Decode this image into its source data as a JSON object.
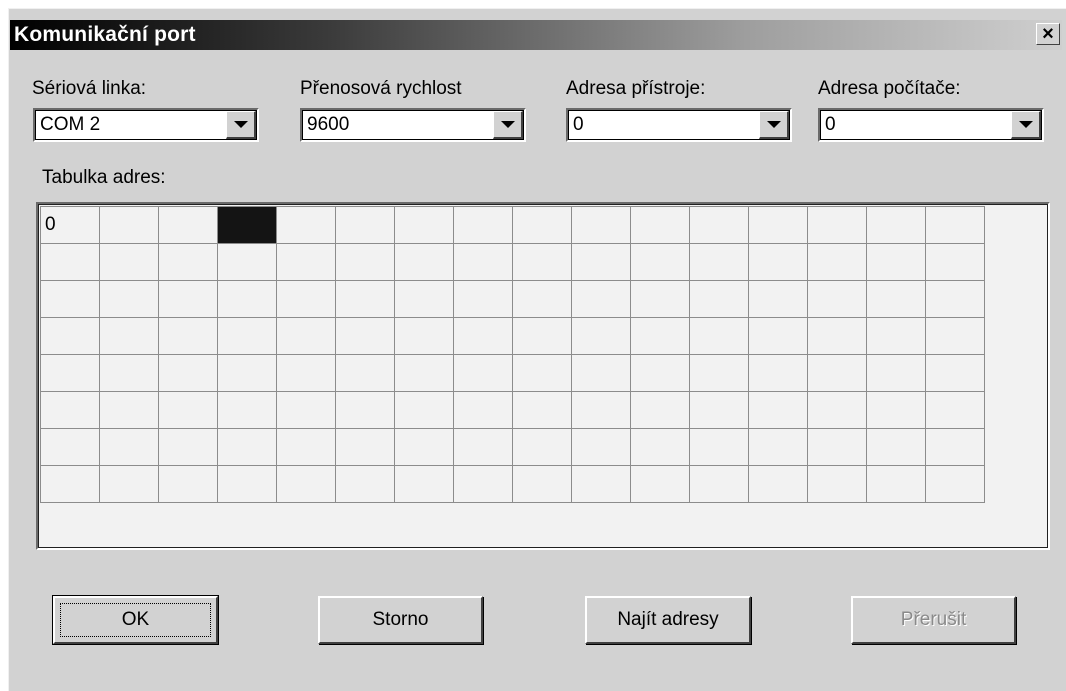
{
  "window": {
    "title": "Komunikační port",
    "close_label": "×"
  },
  "fields": [
    {
      "label": "Sériová linka:",
      "value": "COM 2"
    },
    {
      "label": "Přenosová rychlost",
      "value": "9600"
    },
    {
      "label": "Adresa přístroje:",
      "value": "0"
    },
    {
      "label": "Adresa počítače:",
      "value": "0"
    }
  ],
  "table": {
    "label": "Tabulka adres:",
    "columns": 16,
    "rows": 8,
    "first_cell": "0",
    "selected_cell": {
      "row": 0,
      "col": 3
    }
  },
  "buttons": {
    "ok": "OK",
    "cancel": "Storno",
    "find": "Najít adresy",
    "interrupt": "Přerušit"
  },
  "colors": {
    "dialog_bg": "#d2d2d2",
    "selected_cell": "#141414",
    "disabled_text": "#8a8a8a"
  }
}
